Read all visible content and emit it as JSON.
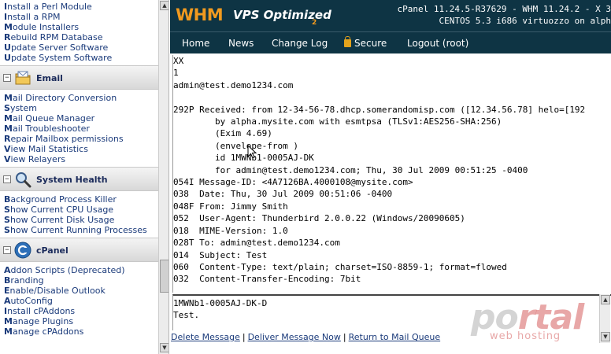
{
  "sidebar": {
    "top_links": [
      {
        "first": "I",
        "rest": "nstall a Perl Module"
      },
      {
        "first": "I",
        "rest": "nstall a RPM"
      },
      {
        "first": "M",
        "rest": "odule Installers"
      },
      {
        "first": "R",
        "rest": "ebuild RPM Database"
      },
      {
        "first": "U",
        "rest": "pdate Server Software"
      },
      {
        "first": "U",
        "rest": "pdate System Software"
      }
    ],
    "email": {
      "title": "Email",
      "links": [
        {
          "first": "M",
          "rest": "ail Directory Conversion"
        },
        {
          "first": "S",
          "rest": "ystem"
        },
        {
          "first": "M",
          "rest": "ail Queue Manager"
        },
        {
          "first": "M",
          "rest": "ail Troubleshooter"
        },
        {
          "first": "R",
          "rest": "epair Mailbox permissions"
        },
        {
          "first": "V",
          "rest": "iew Mail Statistics"
        },
        {
          "first": "V",
          "rest": "iew Relayers"
        }
      ]
    },
    "system_health": {
      "title": "System Health",
      "links": [
        {
          "first": "B",
          "rest": "ackground Process Killer"
        },
        {
          "first": "S",
          "rest": "how Current CPU Usage"
        },
        {
          "first": "S",
          "rest": "how Current Disk Usage"
        },
        {
          "first": "S",
          "rest": "how Current Running Processes"
        }
      ]
    },
    "cpanel": {
      "title": "cPanel",
      "links": [
        {
          "first": "A",
          "rest": "ddon Scripts (Deprecated)"
        },
        {
          "first": "B",
          "rest": "randing"
        },
        {
          "first": "E",
          "rest": "nable/Disable Outlook"
        },
        {
          "first": "A",
          "rest": "utoConfig"
        },
        {
          "first": "I",
          "rest": "nstall cPAddons"
        },
        {
          "first": "M",
          "rest": "anage Plugins"
        },
        {
          "first": "M",
          "rest": "anage cPAddons"
        }
      ]
    },
    "toggle_symbol": "−"
  },
  "header": {
    "logo_whm": "WHM",
    "logo_vps": "VPS Optimized",
    "logo_sub": "2",
    "info_line1": "cPanel 11.24.5-R37629 - WHM 11.24.2 - X 3",
    "info_line2": "CENTOS 5.3 i686 virtuozzo on alph"
  },
  "nav": {
    "home": "Home",
    "news": "News",
    "changelog": "Change Log",
    "secure": "Secure",
    "logout": "Logout (root)"
  },
  "message": {
    "headers_text": "XX\n1\nadmin@test.demo1234.com\n\n292P Received: from 12-34-56-78.dhcp.somerandomisp.com ([12.34.56.78] helo=[192\n        by alpha.mysite.com with esmtpsa (TLSv1:AES256-SHA:256)\n        (Exim 4.69)\n        (envelope-from )\n        id 1MWNb1-0005AJ-DK\n        for admin@test.demo1234.com; Thu, 30 Jul 2009 00:51:25 -0400\n054I Message-ID: <4A7126BA.4000108@mysite.com>\n038  Date: Thu, 30 Jul 2009 00:51:06 -0400\n048F From: Jimmy Smith\n052  User-Agent: Thunderbird 2.0.0.22 (Windows/20090605)\n018  MIME-Version: 1.0\n028T To: admin@test.demo1234.com\n014  Subject: Test\n060  Content-Type: text/plain; charset=ISO-8859-1; format=flowed\n032  Content-Transfer-Encoding: 7bit",
    "body_text": "1MWNb1-0005AJ-DK-D\nTest."
  },
  "actions": {
    "delete": "Delete Message",
    "deliver": "Deliver Message Now",
    "return": "Return to Mail Queue",
    "separator": "|"
  },
  "watermark": {
    "brand_left": "po",
    "brand_right": "rtal",
    "tagline": "web hosting"
  },
  "colors": {
    "header_bg": "#0e3444",
    "logo_orange": "#f19a1f",
    "link_blue": "#1a3a7a"
  },
  "icons": {
    "email": "envelope-folder-icon",
    "system_health": "magnifier-icon",
    "cpanel": "cpanel-logo-icon",
    "secure": "lock-icon"
  }
}
